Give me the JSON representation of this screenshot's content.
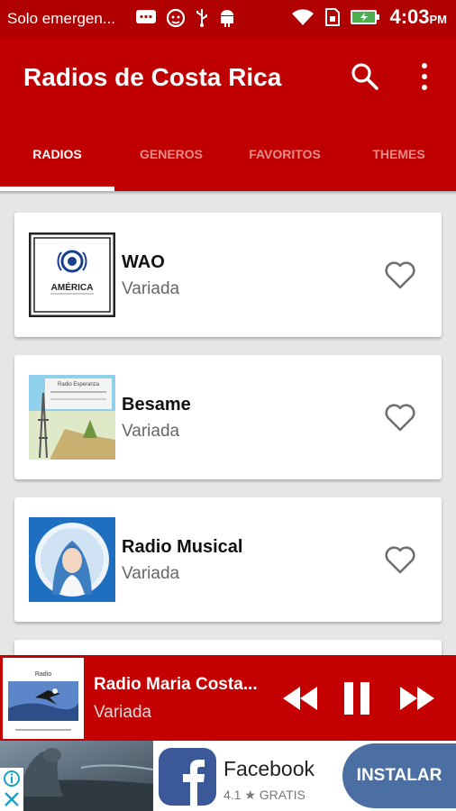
{
  "status_bar": {
    "carrier": "Solo emergen...",
    "time": "4:03",
    "time_suffix": "PM"
  },
  "app": {
    "title": "Radios de Costa Rica",
    "accent": "#c00000"
  },
  "toolbar": {
    "search_icon": "search-icon",
    "more_icon": "more-vert-icon"
  },
  "tabs": [
    {
      "label": "RADIOS",
      "active": true
    },
    {
      "label": "GENEROS",
      "active": false
    },
    {
      "label": "FAVORITOS",
      "active": false
    },
    {
      "label": "THEMES",
      "active": false
    }
  ],
  "stations": [
    {
      "name": "WAO",
      "genre": "Variada",
      "logo_text": "AMÉRICA",
      "favorite": false
    },
    {
      "name": "Besame",
      "genre": "Variada",
      "logo_text": "Radio Esperanza",
      "favorite": false
    },
    {
      "name": "Radio Musical",
      "genre": "Variada",
      "favorite": false
    }
  ],
  "player": {
    "name": "Radio Maria Costa...",
    "genre": "Variada",
    "logo_text": "Radio",
    "state": "playing"
  },
  "ad": {
    "app_name": "Facebook",
    "rating": "4.1 ★ GRATIS",
    "install_label": "INSTALAR"
  }
}
